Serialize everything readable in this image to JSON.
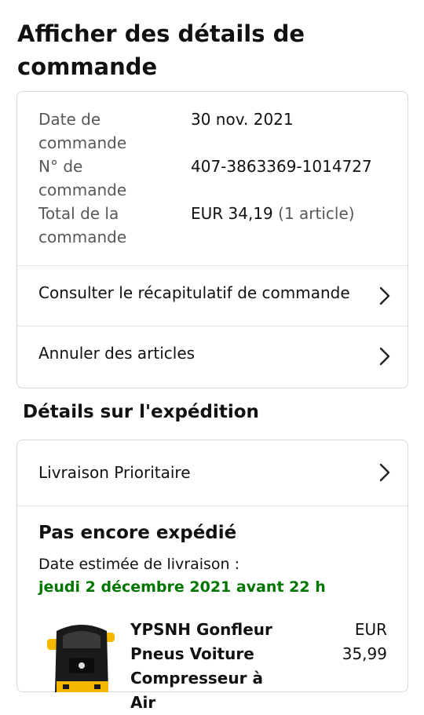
{
  "page": {
    "title": "Afficher des détails de commande"
  },
  "order_info": [
    {
      "label": "Date de commande",
      "value": "30 nov. 2021",
      "extra": ""
    },
    {
      "label": "N° de commande",
      "value": "407-3863369-1014727",
      "extra": ""
    },
    {
      "label": "Total de la commande",
      "value": "EUR 34,19",
      "extra": "(1 article)"
    }
  ],
  "links": {
    "summary": "Consulter le récapitulatif de commande",
    "cancel": "Annuler des articles"
  },
  "shipping": {
    "section_title": "Détails sur l'expédition",
    "method": "Livraison Prioritaire",
    "status": "Pas encore expédié",
    "estimate_label": "Date estimée de livraison :",
    "estimate_date": "jeudi 2 décembre 2021 avant 22 h",
    "colors": {
      "delivery_green": "#007600",
      "product_yellow": "#f5b800"
    }
  },
  "product": {
    "name": "YPSNH Gonfleur Pneus Voiture Compresseur à Air",
    "currency": "EUR",
    "price": "35,99",
    "icon": "tire-inflator-image"
  }
}
